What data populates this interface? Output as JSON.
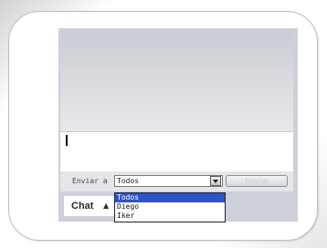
{
  "send_bar": {
    "label": "Enviar a",
    "select_value": "Todos",
    "send_button": "Enviar"
  },
  "tab": {
    "label": "Chat",
    "arrow": "▲"
  },
  "dropdown": {
    "options": [
      "Todos",
      "Diego",
      "Iker"
    ],
    "selected_index": 0
  },
  "colors": {
    "panel": "#cdd0d8",
    "selection": "#2d55c8"
  }
}
